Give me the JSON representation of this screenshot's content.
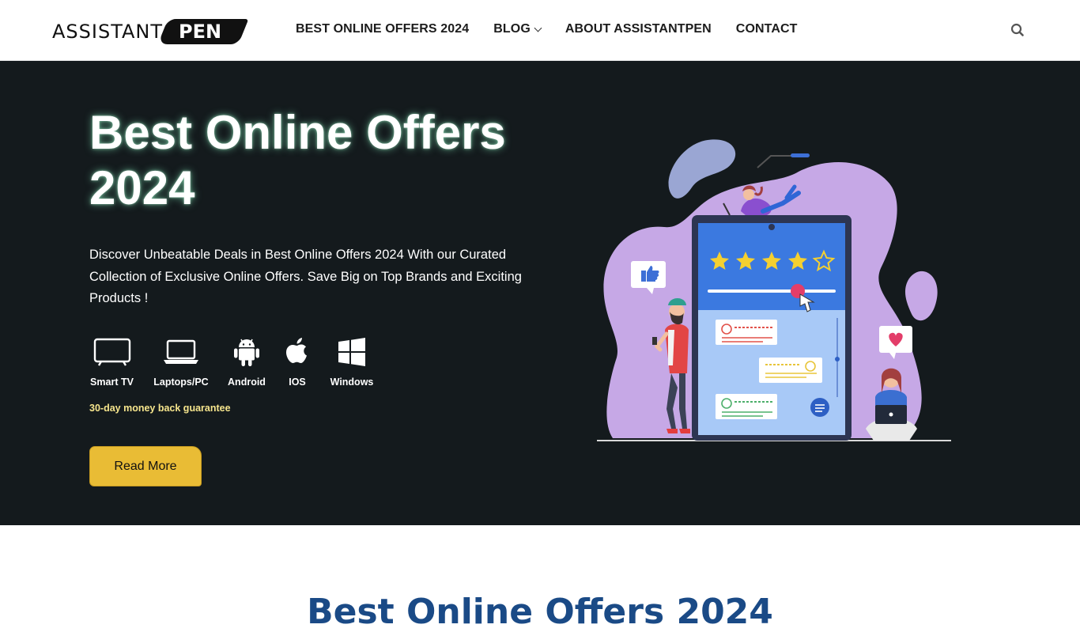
{
  "header": {
    "logo_text_1": "ASSISTANT",
    "logo_text_2": "PEN",
    "nav": [
      {
        "label": "BEST ONLINE OFFERS 2024"
      },
      {
        "label": "BLOG"
      },
      {
        "label": "ABOUT ASSISTANTPEN"
      },
      {
        "label": "CONTACT"
      }
    ],
    "search_icon": "search-icon"
  },
  "hero": {
    "title": "Best Online Offers 2024",
    "description": "Discover Unbeatable Deals in Best Online Offers 2024 With our Curated Collection of Exclusive Online Offers. Save Big on Top Brands and Exciting Products !",
    "platforms": [
      {
        "label": "Smart TV",
        "icon": "tv-icon"
      },
      {
        "label": "Laptops/PC",
        "icon": "laptop-icon"
      },
      {
        "label": "Android",
        "icon": "android-icon"
      },
      {
        "label": "IOS",
        "icon": "apple-icon"
      },
      {
        "label": "Windows",
        "icon": "windows-icon"
      }
    ],
    "guarantee": "30-day money back guarantee",
    "cta": "Read More",
    "rating_stars": 4,
    "colors": {
      "background": "#141a1d",
      "cta": "#e9bc35",
      "guarantee": "#f6e58d"
    }
  },
  "section": {
    "title": "Best Online Offers 2024"
  }
}
